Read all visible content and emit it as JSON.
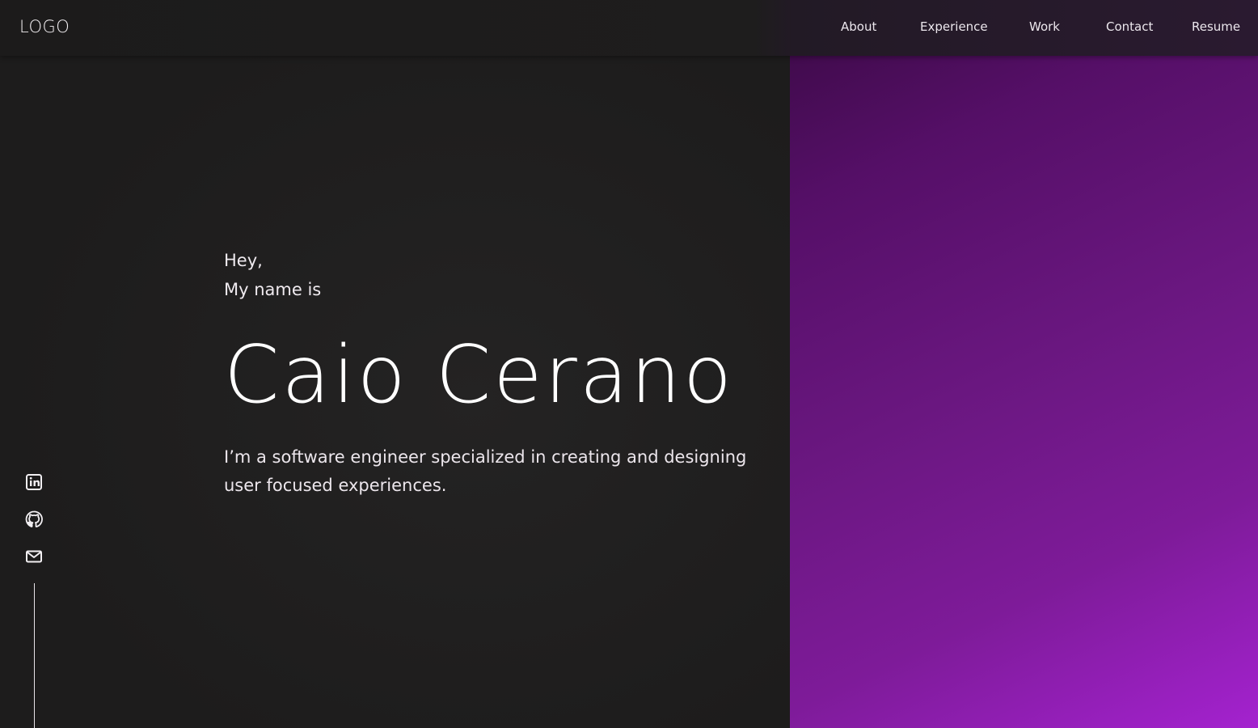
{
  "header": {
    "logo": "LOGO",
    "nav": {
      "about": "About",
      "experience": "Experience",
      "work": "Work",
      "contact": "Contact",
      "resume": "Resume"
    }
  },
  "hero": {
    "greeting_line1": "Hey,",
    "greeting_line2": "My name is",
    "name": "Caio Cerano",
    "tagline": "I’m a software engineer specialized in creating and designing user focused experiences."
  },
  "social": {
    "icons": [
      "linkedin-icon",
      "github-icon",
      "mail-icon"
    ]
  },
  "colors": {
    "background": "#1f1e1e",
    "accent_gradient_start": "#3a0a44",
    "accent_gradient_end": "#a422cf",
    "text": "#f2eff2"
  }
}
